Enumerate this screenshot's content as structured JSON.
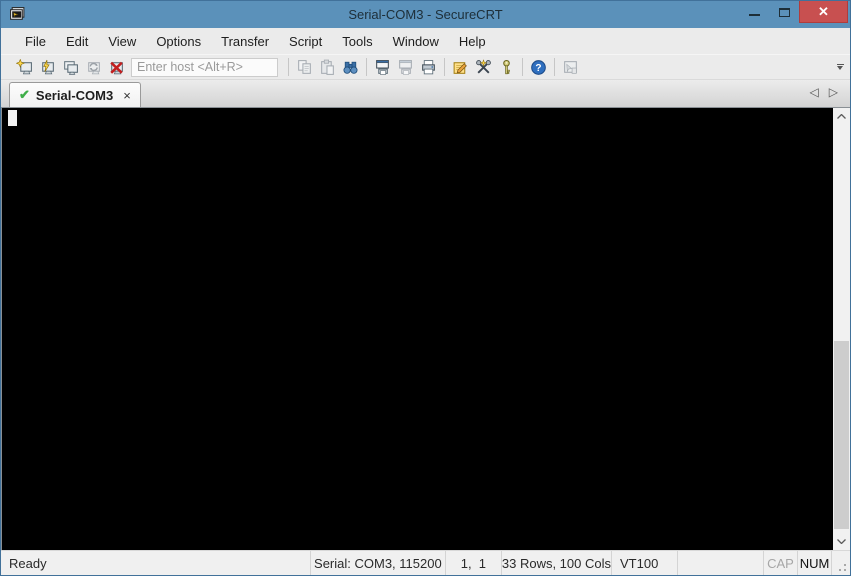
{
  "window": {
    "title": "Serial-COM3 - SecureCRT"
  },
  "titlebar": {
    "app_icon": "securecrt-app-icon",
    "controls": {
      "minimize": "minimize",
      "maximize": "maximize",
      "close_glyph": "✕"
    }
  },
  "menubar": {
    "items": [
      "File",
      "Edit",
      "View",
      "Options",
      "Transfer",
      "Script",
      "Tools",
      "Window",
      "Help"
    ]
  },
  "toolbar": {
    "host_input": {
      "placeholder": "Enter host <Alt+R>",
      "value": ""
    },
    "icons": [
      "quick-connect",
      "connect",
      "connect-in-tab",
      "reconnect",
      "disconnect",
      "copy",
      "paste",
      "find",
      "print-screen",
      "print-eject",
      "print",
      "session-options",
      "keymap-editor",
      "public-key",
      "help",
      "sftp-session",
      "toolbar-overflow"
    ]
  },
  "tabbar": {
    "tabs": [
      {
        "label": "Serial-COM3",
        "status_icon": "connected-check-icon",
        "check_glyph": "✔",
        "close_glyph": "×"
      }
    ],
    "scroll_left_glyph": "◁",
    "scroll_right_glyph": "▷"
  },
  "terminal": {
    "content": "",
    "cursor": "block"
  },
  "statusbar": {
    "ready": "Ready",
    "connection": "Serial: COM3, 115200",
    "cursor_position": "1,  1",
    "grid_size": "33 Rows, 100 Cols",
    "emulation": "VT100",
    "caps_indicator": "CAP",
    "num_indicator": "NUM"
  },
  "colors": {
    "titlebar": "#5b91ba",
    "close_button": "#c85050",
    "terminal_bg": "#000000",
    "tab_check_green": "#3fae49"
  }
}
